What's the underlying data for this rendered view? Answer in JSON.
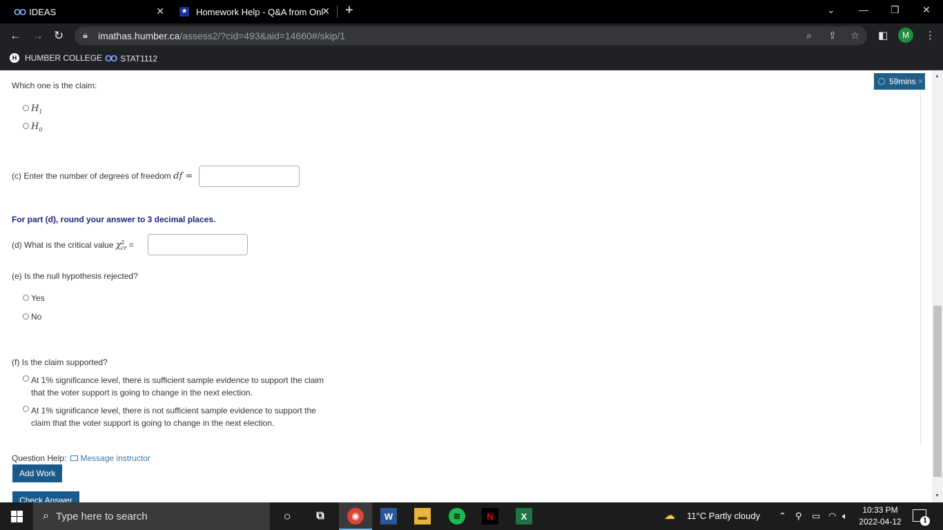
{
  "browser": {
    "tabs": [
      {
        "title": "IDEAS"
      },
      {
        "title": "Homework Help - Q&A from Onl"
      }
    ],
    "url_host": "imathas.humber.ca",
    "url_path": "/assess2/?cid=493&aid=14660#/skip/1",
    "avatar_letter": "M",
    "bookmarks": [
      {
        "label": "HUMBER COLLEGE"
      },
      {
        "label": "STAT1112"
      }
    ]
  },
  "timer": {
    "label": "59mins"
  },
  "question": {
    "claim_prompt": "Which one is the claim:",
    "claim_options": [
      "H",
      "H"
    ],
    "claim_subscripts": [
      "1",
      "0"
    ],
    "part_c_label": "(c) Enter the number of degrees of freedom ",
    "part_c_math": "df =",
    "notice": "For part (d), round your answer to 3 decimal places.",
    "part_d_label": "(d) What is the critical value ",
    "part_d_math": "χ",
    "part_d_sup": "2",
    "part_d_sub": "cr",
    "part_d_eq": "=",
    "part_e_label": "(e) Is the null hypothesis rejected?",
    "part_e_options": [
      "Yes",
      "No"
    ],
    "part_f_label": "(f) Is the claim supported?",
    "part_f_options": [
      "At 1% significance level, there is sufficient sample evidence to support the claim that the voter support is going to change in the next election.",
      "At 1% significance level, there is not sufficient sample evidence to support the claim that the voter support is going to change in the next election."
    ],
    "help_label": "Question Help:",
    "message_link": "Message instructor",
    "add_work": "Add Work",
    "check_answer": "Check Answer"
  },
  "taskbar": {
    "search_placeholder": "Type here to search",
    "weather": "11°C  Partly cloudy",
    "time": "10:33 PM",
    "date": "2022-04-12",
    "notification_count": "1"
  },
  "colors": {
    "accent": "#1a5a8a",
    "notice": "#1a237e",
    "link": "#3a78a8"
  }
}
